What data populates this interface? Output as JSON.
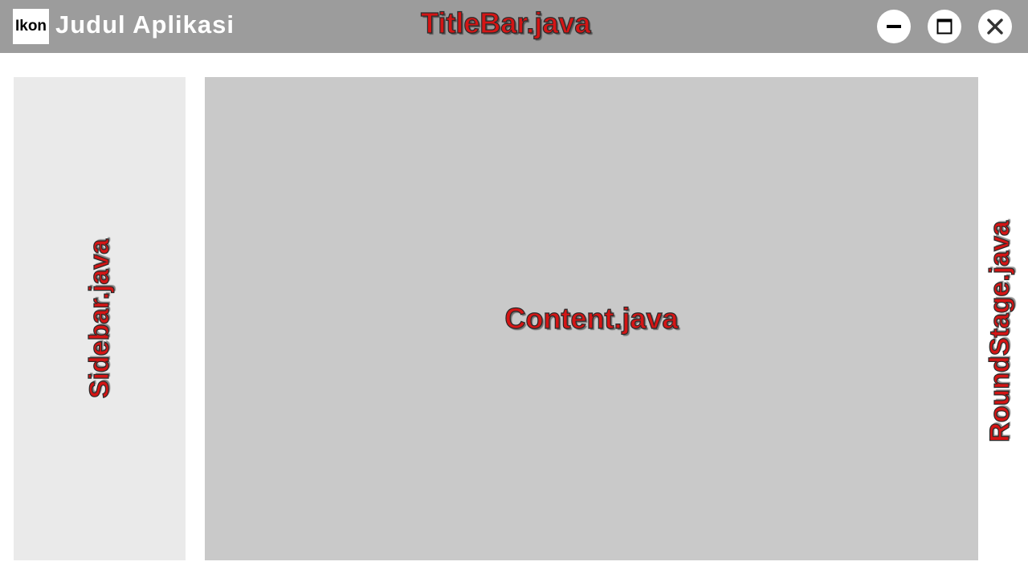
{
  "titlebar": {
    "icon_label": "Ikon",
    "app_title": "Judul Aplikasi",
    "component_label": "TitleBar.java",
    "buttons": {
      "minimize_icon": "minimize-icon",
      "maximize_icon": "maximize-icon",
      "close_icon": "close-icon"
    }
  },
  "sidebar": {
    "component_label": "Sidebar.java"
  },
  "content": {
    "component_label": "Content.java"
  },
  "stage": {
    "component_label": "RoundStage.java"
  },
  "colors": {
    "titlebar_bg": "#9c9c9c",
    "sidebar_bg": "#eaeaea",
    "content_bg": "#c9c9c9",
    "label_red": "#d41515"
  }
}
